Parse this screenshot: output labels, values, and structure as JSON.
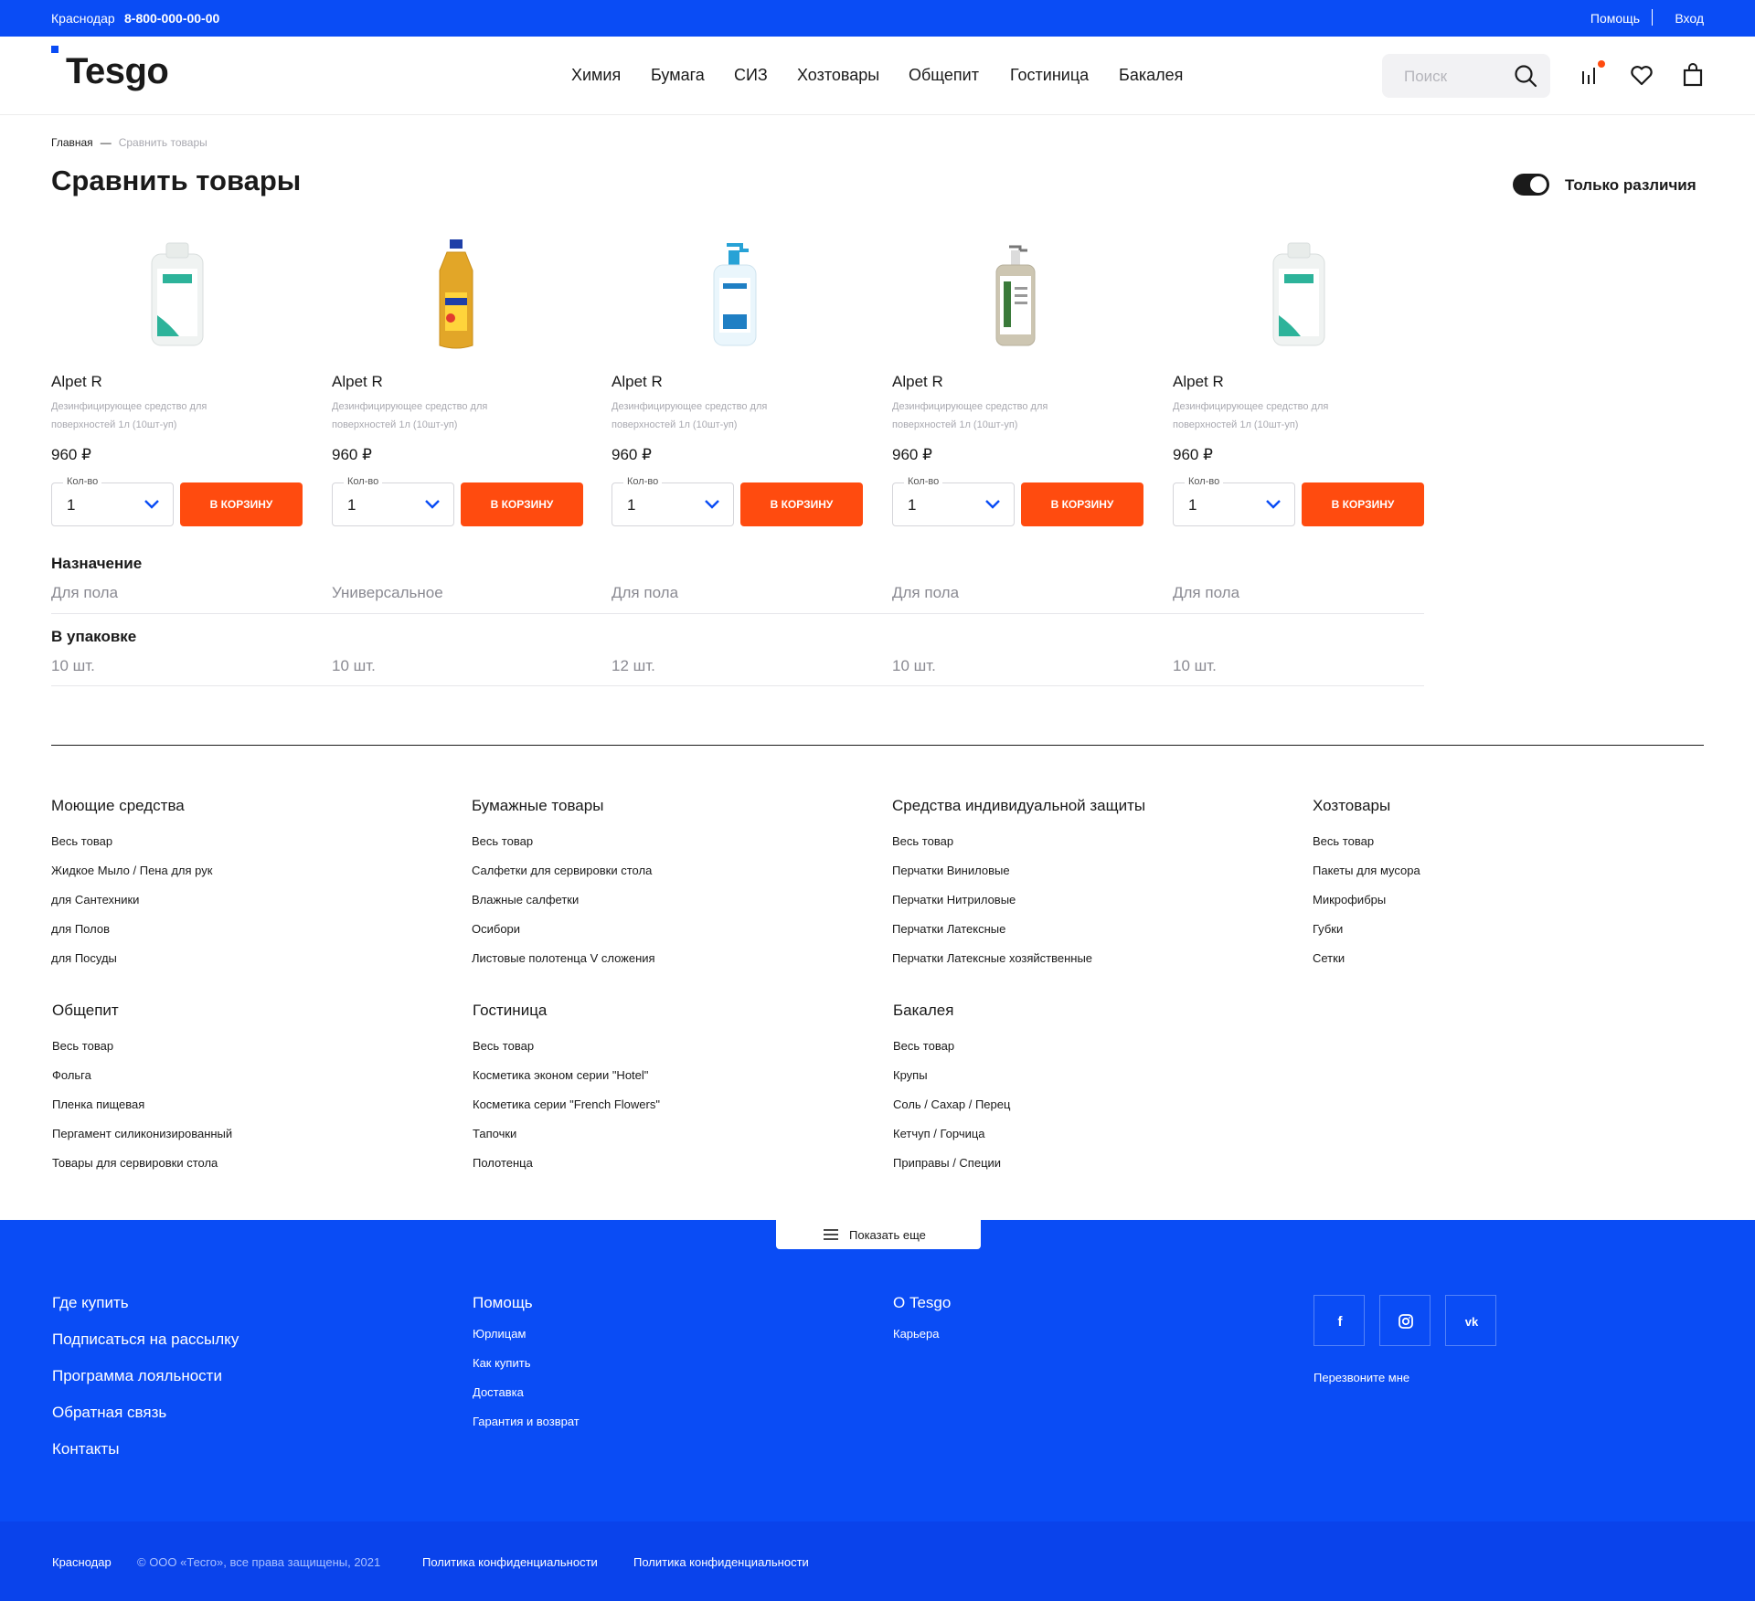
{
  "topbar": {
    "city": "Краснодар",
    "phone": "8-800-000-00-00",
    "help": "Помощь",
    "login": "Вход"
  },
  "header": {
    "logo": "Tesgo",
    "nav": [
      "Химия",
      "Бумага",
      "СИЗ",
      "Хозтовары",
      "Общепит",
      "Гостиница",
      "Бакалея"
    ],
    "search_placeholder": "Поиск",
    "icons": [
      "search-icon",
      "compare-icon",
      "heart-icon",
      "bag-icon"
    ],
    "accent": "#0a4cf5",
    "notify": "#ff4b0f"
  },
  "breadcrumb": {
    "home": "Главная",
    "current": "Сравнить товары"
  },
  "page": {
    "title": "Сравнить товары",
    "toggle_label": "Только различия",
    "toggle_on": true
  },
  "products": [
    {
      "name": "Alpet R",
      "desc": "Дезинфицирующее средство для поверхностей 1л (10шт-уп)",
      "price": "960 ₽",
      "qty_label": "Кол-во",
      "qty": "1",
      "buy": "В КОРЗИНУ",
      "image": "white-canister-bottle"
    },
    {
      "name": "Alpet R",
      "desc": "Дезинфицирующее средство для поверхностей 1л (10шт-уп)",
      "price": "960 ₽",
      "qty_label": "Кол-во",
      "qty": "1",
      "buy": "В КОРЗИНУ",
      "image": "yellow-bottle"
    },
    {
      "name": "Alpet R",
      "desc": "Дезинфицирующее средство для поверхностей 1л (10шт-уп)",
      "price": "960 ₽",
      "qty_label": "Кол-во",
      "qty": "1",
      "buy": "В КОРЗИНУ",
      "image": "pump-dispenser-bottle"
    },
    {
      "name": "Alpet R",
      "desc": "Дезинфицирующее средство для поверхностей 1л (10шт-уп)",
      "price": "960 ₽",
      "qty_label": "Кол-во",
      "qty": "1",
      "buy": "В КОРЗИНУ",
      "image": "beige-pump-bottle"
    },
    {
      "name": "Alpet R",
      "desc": "Дезинфицирующее средство для поверхностей 1л (10шт-уп)",
      "price": "960 ₽",
      "qty_label": "Кол-во",
      "qty": "1",
      "buy": "В КОРЗИНУ",
      "image": "white-canister-bottle"
    }
  ],
  "specs": [
    {
      "title": "Назначение",
      "values": [
        "Для пола",
        "Универсальное",
        "Для пола",
        "Для пола",
        "Для пола"
      ]
    },
    {
      "title": "В упаковке",
      "values": [
        "10 шт.",
        "10 шт.",
        "12 шт.",
        "10 шт.",
        "10 шт."
      ]
    }
  ],
  "catalog": [
    {
      "title": "Моющие средства",
      "items": [
        "Весь товар",
        "Жидкое Мыло / Пена для рук",
        "для Сантехники",
        "для Полов",
        "для Посуды"
      ]
    },
    {
      "title": "Бумажные товары",
      "items": [
        "Весь товар",
        "Салфетки для сервировки стола",
        "Влажные салфетки",
        "Осибори",
        "Листовые полотенца V сложения"
      ]
    },
    {
      "title": "Средства индивидуальной защиты",
      "items": [
        "Весь товар",
        "Перчатки Виниловые",
        "Перчатки Нитриловые",
        "Перчатки Латексные",
        "Перчатки Латексные хозяйственные"
      ]
    },
    {
      "title": "Хозтовары",
      "items": [
        "Весь товар",
        "Пакеты для мусора",
        "Микрофибры",
        "Губки",
        "Сетки"
      ]
    },
    {
      "title": "Общепит",
      "items": [
        "Весь товар",
        "Фольга",
        "Пленка пищевая",
        "Пергамент силиконизированный",
        "Товары для сервировки стола"
      ]
    },
    {
      "title": "Гостиница",
      "items": [
        "Весь товар",
        "Косметика эконом серии \"Hotel\"",
        "Косметика серии \"French Flowers\"",
        "Тапочки",
        "Полотенца"
      ]
    },
    {
      "title": "Бакалея",
      "items": [
        "Весь товар",
        "Крупы",
        "Соль / Сахар / Перец",
        "Кетчуп / Горчица",
        "Приправы / Специи"
      ]
    }
  ],
  "footer": {
    "show_more": "Показать еще",
    "col1": [
      "Где купить",
      "Подписаться на рассылку",
      "Программа лояльности",
      "Обратная связь",
      "Контакты"
    ],
    "col2_title": "Помощь",
    "col2": [
      "Юрлицам",
      "Как купить",
      "Доставка",
      "Гарантия и возврат"
    ],
    "col3_title": "О Tesgo",
    "col3": [
      "Карьера"
    ],
    "social": [
      "facebook-icon",
      "instagram-icon",
      "vk-icon"
    ],
    "callback": "Перезвоните мне",
    "bottom": {
      "city": "Краснодар",
      "copyright": "© ООО «Тесго», все права защищены, 2021",
      "policy1": "Политика конфиденциальности",
      "policy2": "Политика конфиденциальности"
    }
  }
}
